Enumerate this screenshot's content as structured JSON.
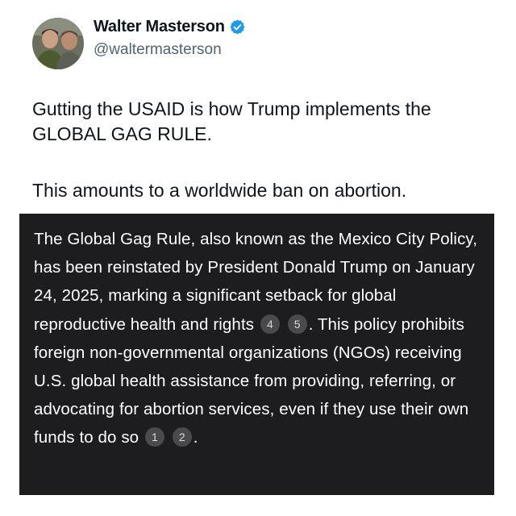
{
  "author": {
    "display_name": "Walter Masterson",
    "handle": "@waltermasterson",
    "verified_icon": "verified-badge-icon",
    "verified_color": "#1d9bf0"
  },
  "tweet": {
    "line1": "Gutting the USAID is how Trump implements the GLOBAL GAG RULE.",
    "line2": "This amounts to a worldwide ban on abortion."
  },
  "quote": {
    "text_part1": "The Global Gag Rule, also known as the Mexico City Policy, has been reinstated by President Donald Trump on January 24, 2025, marking a significant setback for global reproductive health and rights",
    "citation_a": "4",
    "citation_b": "5",
    "text_part2": ". This policy prohibits foreign non-governmental organizations (NGOs) receiving U.S. global health assistance from providing, referring, or advocating for abortion services, even if they use their own funds to do so",
    "citation_c": "1",
    "citation_d": "2",
    "text_part3": ".",
    "background_color": "#1d1d1f"
  }
}
